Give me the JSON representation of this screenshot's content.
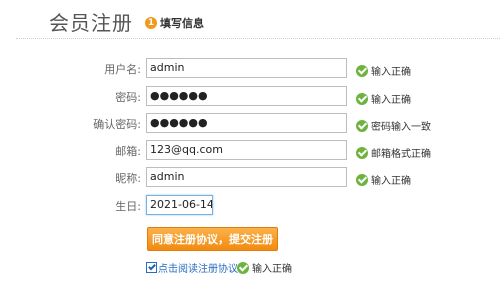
{
  "header": {
    "title": "会员注册",
    "step_number": "1",
    "step_label": "填写信息"
  },
  "form": {
    "rows": [
      {
        "label": "用户名:",
        "value": "admin",
        "hint": "输入正确"
      },
      {
        "label": "密码:",
        "value": "●●●●●●",
        "hint": "输入正确"
      },
      {
        "label": "确认密码:",
        "value": "●●●●●●",
        "hint": "密码输入一致"
      },
      {
        "label": "邮箱:",
        "value": "123@qq.com",
        "hint": "邮箱格式正确"
      },
      {
        "label": "昵称:",
        "value": "admin",
        "hint": "输入正确"
      },
      {
        "label": "生日:",
        "value": "2021-06-14"
      }
    ],
    "submit_label": "同意注册协议，提交注册",
    "agree_label": "点击阅读注册协议",
    "agree_checked": true,
    "agree_hint": "输入正确"
  },
  "colors": {
    "accent": "#f28a10",
    "success": "#6db33f",
    "link": "#2a6cc0"
  },
  "icons": {
    "valid": "check-circle-icon",
    "step": "step-number-badge"
  }
}
